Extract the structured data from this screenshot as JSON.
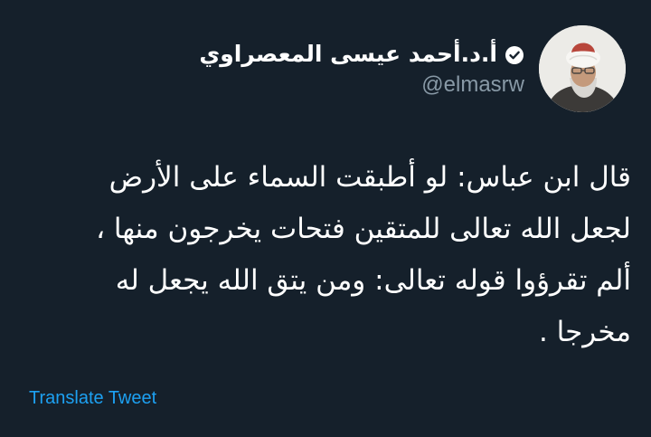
{
  "author": {
    "display_name": "أ.د.أحمد عيسى المعصراوي",
    "handle": "@elmasrw",
    "verified": true
  },
  "tweet": {
    "lines": [
      "قال ابن عباس: لو أطبقت السماء على الأرض",
      "لجعل الله تعالى للمتقين فتحات يخرجون منها ،",
      "ألم تقرؤوا قوله تعالى: ومن يتق الله يجعل له",
      "مخرجا ."
    ]
  },
  "actions": {
    "translate_label": "Translate Tweet",
    "menu_icon": "chevron-down-icon"
  },
  "colors": {
    "background": "#15202b",
    "text": "#ffffff",
    "secondary_text": "#8899a6",
    "accent": "#1da1f2"
  }
}
